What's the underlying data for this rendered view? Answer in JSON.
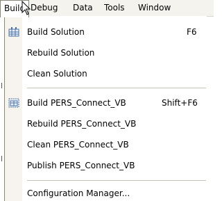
{
  "menubar": {
    "items": [
      {
        "label": "Build"
      },
      {
        "label": "Debug"
      },
      {
        "label": "Data"
      },
      {
        "label": "Tools"
      },
      {
        "label": "Window"
      }
    ]
  },
  "build_menu": {
    "items": [
      {
        "label": "Build Solution",
        "shortcut": "F6",
        "icon": "build-solution-icon"
      },
      {
        "label": "Rebuild Solution"
      },
      {
        "label": "Clean Solution"
      },
      {
        "label": "Build PERS_Connect_VB",
        "shortcut": "Shift+F6",
        "icon": "build-project-icon"
      },
      {
        "label": "Rebuild PERS_Connect_VB"
      },
      {
        "label": "Clean PERS_Connect_VB"
      },
      {
        "label": "Publish PERS_Connect_VB"
      },
      {
        "label": "Configuration Manager..."
      }
    ]
  },
  "colors": {
    "menubar_bg": "#f4f3ee",
    "icon_column_bg": "#f6f4ec",
    "border": "#8a867a"
  }
}
